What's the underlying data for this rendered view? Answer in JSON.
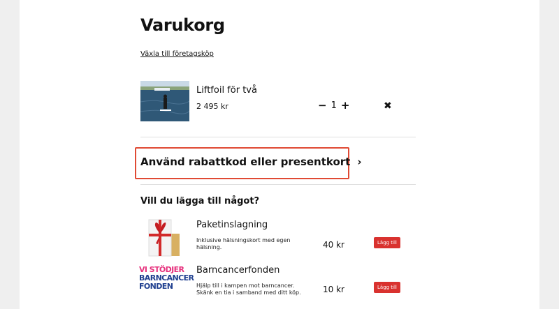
{
  "cart": {
    "title": "Varukorg",
    "switch_link": "Växla till företagsköp",
    "item": {
      "name": "Liftfoil för två",
      "price": "2 495 kr",
      "quantity": "1"
    },
    "icons": {
      "minus": "−",
      "plus": "+",
      "remove": "✖"
    }
  },
  "discount": {
    "label": "Använd rabattkod eller presentkort",
    "chevron": "›",
    "highlight_color": "#e04a34"
  },
  "addons": {
    "heading": "Vill du lägga till något?",
    "items": [
      {
        "name": "Paketinslagning",
        "description": "Inklusive hälsningskort med egen hälsning.",
        "price": "40 kr",
        "button": "Lägg till"
      },
      {
        "name": "Barncancerfonden",
        "description": "Hjälp till i kampen mot barncancer. Skänk en tia i samband med ditt köp.",
        "price": "10 kr",
        "button": "Lägg till",
        "logo_lines": [
          "VI STÖDJER",
          "BARNCANCER",
          "FONDEN"
        ]
      }
    ]
  },
  "colors": {
    "button_red": "#d9322f",
    "logo_pink": "#e6317d",
    "logo_blue": "#1f3f8f"
  }
}
